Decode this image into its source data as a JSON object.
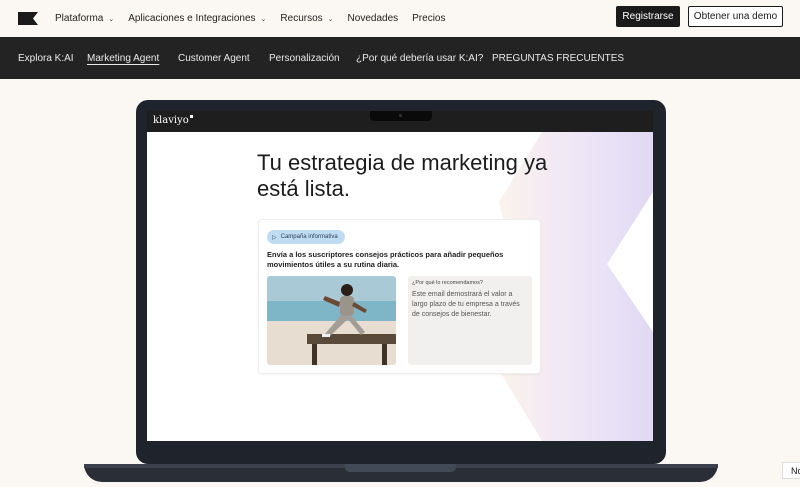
{
  "header": {
    "nav": [
      {
        "label": "Plataforma",
        "has_dropdown": true
      },
      {
        "label": "Aplicaciones e Integraciones",
        "has_dropdown": true
      },
      {
        "label": "Recursos",
        "has_dropdown": true
      },
      {
        "label": "Novedades",
        "has_dropdown": false
      },
      {
        "label": "Precios",
        "has_dropdown": false
      }
    ],
    "signup_label": "Registrarse",
    "demo_label": "Obtener una demo"
  },
  "subnav": {
    "items": [
      "Explora K:AI",
      "Marketing Agent",
      "Customer Agent",
      "Personalización",
      "¿Por qué debería usar K:AI?",
      "PREGUNTAS FRECUENTES"
    ],
    "active": "Marketing Agent"
  },
  "laptop": {
    "brand": "klaviyo",
    "headline": "Tu estrategia de marketing ya está lista.",
    "card": {
      "tag": "Campaña informativa",
      "description": "Envía a los suscriptores consejos prácticos para añadir pequeños movimientos útiles a su rutina diaria.",
      "reason_title": "¿Por qué lo recomendamos?",
      "reason_text": "Este email demostrará el valor a largo plazo de tu empresa a través de consejos de bienestar."
    }
  },
  "corner_chip": "No",
  "colors": {
    "page_bg": "#fbf8f3",
    "subnav_bg": "#232323",
    "accent_lavender": "#e3dcf3",
    "pill_blue": "#bfdcf2"
  }
}
